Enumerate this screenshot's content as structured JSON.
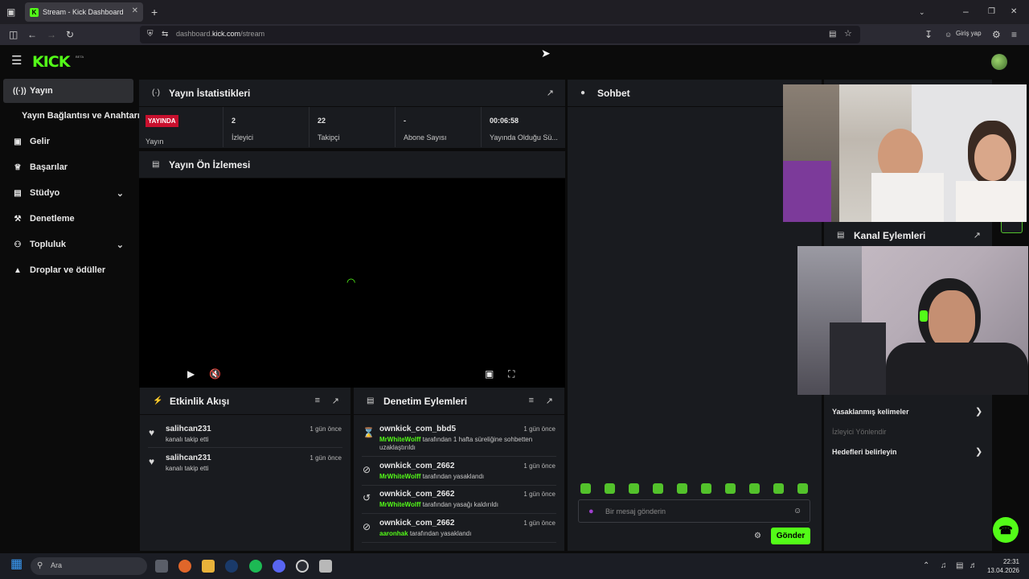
{
  "browser": {
    "tab_title": "Stream - Kick Dashboard",
    "url_prefix": "dashboard.",
    "url_domain": "kick.com",
    "url_path": "/stream",
    "signin_label": "Giriş yap"
  },
  "brand": {
    "logo_text": "KICK",
    "beta_text": "BETA",
    "accent": "#53fc18"
  },
  "sidebar": {
    "items": [
      {
        "label": "Yayın",
        "icon": "broadcast-icon",
        "active": true
      },
      {
        "label": "Yayın Bağlantısı ve Anahtarı",
        "icon": "",
        "active": false
      },
      {
        "label": "Gelir",
        "icon": "wallet-icon",
        "active": false
      },
      {
        "label": "Başarılar",
        "icon": "trophy-icon",
        "active": false
      },
      {
        "label": "Stüdyo",
        "icon": "studio-icon",
        "active": false
      },
      {
        "label": "Denetleme",
        "icon": "wrench-icon",
        "active": false
      },
      {
        "label": "Topluluk",
        "icon": "community-icon",
        "active": false
      },
      {
        "label": "Droplar ve ödüller",
        "icon": "rewards-icon",
        "active": false
      }
    ]
  },
  "stats": {
    "title": "Yayın İstatistikleri",
    "live_badge": "YAYINDA",
    "live_label": "Yayın",
    "items": [
      {
        "value": "2",
        "label": "İzleyici"
      },
      {
        "value": "22",
        "label": "Takipçi"
      },
      {
        "value": "-",
        "label": "Abone Sayısı"
      },
      {
        "value": "00:06:58",
        "label": "Yayında Olduğu Sü..."
      }
    ]
  },
  "preview": {
    "title": "Yayın Ön İzlemesi"
  },
  "activity": {
    "title": "Etkinlik Akışı",
    "items": [
      {
        "user": "salihcan231",
        "time": "1 gün önce",
        "desc": "kanalı takip etti"
      },
      {
        "user": "salihcan231",
        "time": "1 gün önce",
        "desc": "kanalı takip etti"
      }
    ]
  },
  "moderation": {
    "title": "Denetim Eylemleri",
    "items": [
      {
        "user": "ownkick_com_bbd5",
        "time": "1 gün önce",
        "mod": "MrWhiteWolff",
        "desc": "tarafından 1 hafta süreliğine sohbetten uzaklaştırıldı"
      },
      {
        "user": "ownkick_com_2662",
        "time": "1 gün önce",
        "mod": "MrWhiteWolff",
        "desc": "tarafından yasaklandı"
      },
      {
        "user": "ownkick_com_2662",
        "time": "1 gün önce",
        "mod": "MrWhiteWolff",
        "desc": "tarafından yasağı kaldırıldı"
      },
      {
        "user": "ownkick_com_2662",
        "time": "1 gün önce",
        "mod": "aaronhak",
        "desc": "tarafından yasaklandı"
      }
    ]
  },
  "chat": {
    "title": "Sohbet",
    "placeholder": "Bir mesaj gönderin",
    "send_label": "Gönder"
  },
  "channel_actions": {
    "title": "Kanal Eylemleri",
    "items": [
      {
        "label": "Yasaklanmış kelimeler",
        "enabled": true
      },
      {
        "label": "İzleyici Yönlendir",
        "enabled": false
      },
      {
        "label": "Hedefleri belirleyin",
        "enabled": true
      }
    ]
  },
  "taskbar": {
    "search_label": "Ara",
    "time": "22:31",
    "date": "13.04.2026"
  }
}
